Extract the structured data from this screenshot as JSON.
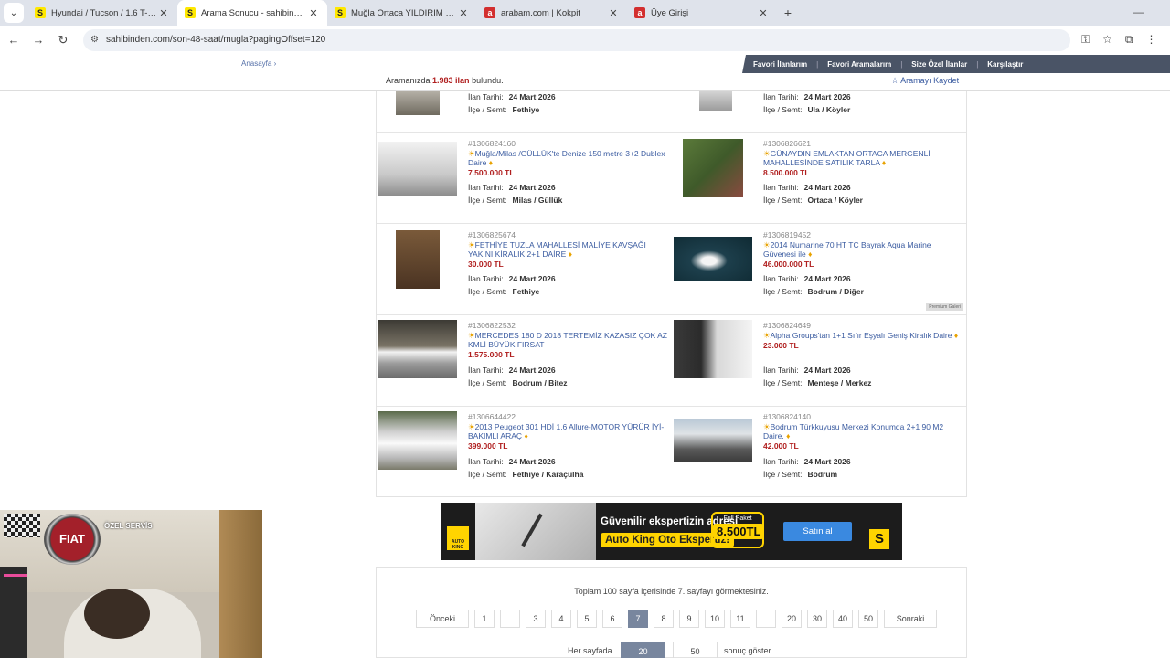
{
  "browser": {
    "tabs": [
      {
        "title": "Hyundai / Tucson / 1.6 T-GDI / ...",
        "favicon": "S",
        "type": "sahibinden",
        "active": false
      },
      {
        "title": "Arama Sonucu - sahibinden.com",
        "favicon": "S",
        "type": "sahibinden",
        "active": true
      },
      {
        "title": "Muğla Ortaca YILDIRIM OTOMOTİ",
        "favicon": "S",
        "type": "sahibinden",
        "active": false
      },
      {
        "title": "arabam.com | Kokpit",
        "favicon": "a",
        "type": "arabam",
        "active": false
      },
      {
        "title": "Üye Girişi",
        "favicon": "a",
        "type": "arabam",
        "active": false
      }
    ],
    "new_tab": "+",
    "url": "sahibinden.com/son-48-saat/mugla?pagingOffset=120"
  },
  "site": {
    "breadcrumb": "Anasayfa ›",
    "fav_menu": [
      "Favori İlanlarım",
      "Favori Aramalarım",
      "Size Özel İlanlar",
      "Karşılaştır"
    ],
    "result_prefix": "Aramanızda ",
    "result_count": "1.983 ilan",
    "result_suffix": " bulundu.",
    "save_search": "☆ Aramayı Kaydet"
  },
  "labels": {
    "date_label": "İlan Tarihi:",
    "location_label": "İlçe / Semt:",
    "premium": "Premium Galeri"
  },
  "listings": [
    {
      "id": "",
      "title": "",
      "price": "",
      "date": "24 Mart 2026",
      "location": "Fethiye"
    },
    {
      "id": "",
      "title": "",
      "price": "",
      "date": "24 Mart 2026",
      "location": "Ula / Köyler"
    },
    {
      "id": "#1306824160",
      "title": "Muğla/Milas /GÜLLÜK'te Denize 150 metre 3+2 Dublex Daire",
      "price": "7.500.000 TL",
      "date": "24 Mart 2026",
      "location": "Milas / Güllük"
    },
    {
      "id": "#1306826621",
      "title": "GÜNAYDIN EMLAKTAN ORTACA MERGENLİ MAHALLESİNDE SATILIK TARLA",
      "price": "8.500.000 TL",
      "date": "24 Mart 2026",
      "location": "Ortaca / Köyler"
    },
    {
      "id": "#1306825674",
      "title": "FETHİYE TUZLA MAHALLESİ MALİYE KAVŞAĞI YAKINI KİRALIK 2+1 DAİRE",
      "price": "30.000 TL",
      "date": "24 Mart 2026",
      "location": "Fethiye"
    },
    {
      "id": "#1306819452",
      "title": "2014 Numarine 70 HT TC Bayrak Aqua Marine Güvenesi ile",
      "price": "46.000.000 TL",
      "date": "24 Mart 2026",
      "location": "Bodrum / Diğer"
    },
    {
      "id": "#1306822532",
      "title": "MERCEDES 180 D 2018 TERTEMİZ KAZASIZ ÇOK AZ KMLİ BÜYÜK FIRSAT",
      "price": "1.575.000 TL",
      "date": "24 Mart 2026",
      "location": "Bodrum / Bitez"
    },
    {
      "id": "#1306824649",
      "title": "Alpha Groups'tan 1+1 Sıfır Eşyalı Geniş Kiralık Daire",
      "price": "23.000 TL",
      "date": "24 Mart 2026",
      "location": "Menteşe / Merkez"
    },
    {
      "id": "#1306644422",
      "title": "2013 Peugeot 301 HDİ 1.6 Allure-MOTOR YÜRÜR İYİ-BAKIMLI ARAÇ",
      "price": "399.000 TL",
      "date": "24 Mart 2026",
      "location": "Fethiye / Karaçulha"
    },
    {
      "id": "#1306824140",
      "title": "Bodrum Türkkuyusu Merkezi Konumda 2+1 90 M2 Daire.",
      "price": "42.000 TL",
      "date": "24 Mart 2026",
      "location": "Bodrum"
    }
  ],
  "ad": {
    "brand": "AUTO KING",
    "headline": "Güvenilir ekspertizin adresi",
    "subline": "Auto King Oto Ekspertiz!",
    "package_label": "Full Paket",
    "package_price": "8.500TL",
    "button": "Satın al",
    "badge": "S"
  },
  "pagination": {
    "info": "Toplam 100 sayfa içerisinde 7. sayfayı görmektesiniz.",
    "prev": "Önceki",
    "next": "Sonraki",
    "pages": [
      "1",
      "...",
      "3",
      "4",
      "5",
      "6",
      "7",
      "8",
      "9",
      "10",
      "11",
      "...",
      "20",
      "30",
      "40",
      "50"
    ],
    "current": "7",
    "per_page_label": "Her sayfada",
    "per_page_options": [
      "20",
      "50"
    ],
    "per_page_selected": "20",
    "per_page_suffix": "sonuç göster"
  },
  "webcam": {
    "logo": "FIAT",
    "sign": "ÖZEL SERVİS"
  },
  "colors": {
    "price": "#b01e1e",
    "link": "#3a5ba0",
    "active_page": "#78869e",
    "fav_bar": "#4a5466"
  }
}
